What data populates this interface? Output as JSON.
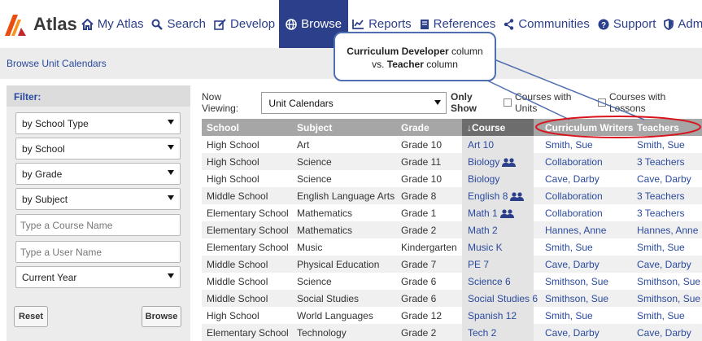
{
  "nav": {
    "logo_text": "Atlas",
    "items": [
      {
        "label": "My Atlas",
        "icon": "home-icon"
      },
      {
        "label": "Search",
        "icon": "search-icon"
      },
      {
        "label": "Develop",
        "icon": "edit-icon"
      },
      {
        "label": "Browse",
        "icon": "globe-icon",
        "active": true
      },
      {
        "label": "Reports",
        "icon": "chart-icon"
      },
      {
        "label": "References",
        "icon": "book-icon"
      },
      {
        "label": "Communities",
        "icon": "share-icon"
      },
      {
        "label": "Support",
        "icon": "question-icon"
      },
      {
        "label": "Admin",
        "icon": "shield-icon"
      }
    ]
  },
  "breadcrumb": "Browse Unit Calendars",
  "filter": {
    "title": "Filter:",
    "school_type": "by School Type",
    "school": "by School",
    "grade": "by Grade",
    "subject": "by Subject",
    "course_placeholder": "Type a Course Name",
    "user_placeholder": "Type a User Name",
    "year": "Current Year",
    "reset": "Reset",
    "browse": "Browse"
  },
  "viewing": {
    "label": "Now Viewing:",
    "value": "Unit Calendars",
    "only_show": "Only Show",
    "opt1": "Courses with Units",
    "opt2": "Courses with Lessons"
  },
  "callout": {
    "bold1": "Curriculum Developer",
    "text1": " column",
    "text2": "vs. ",
    "bold2": "Teacher",
    "text3": " column"
  },
  "table": {
    "headers": {
      "school": "School",
      "subject": "Subject",
      "grade": "Grade",
      "course": "↓Course",
      "writers": "Curriculum Writers",
      "teachers": "Teachers"
    },
    "rows": [
      {
        "school": "High School",
        "subject": "Art",
        "grade": "Grade 10",
        "course": "Art 10",
        "people": false,
        "writers": "Smith, Sue",
        "teachers": "Smith, Sue"
      },
      {
        "school": "High School",
        "subject": "Science",
        "grade": "Grade 11",
        "course": "Biology",
        "people": true,
        "writers": "Collaboration",
        "teachers": "3 Teachers"
      },
      {
        "school": "High School",
        "subject": "Science",
        "grade": "Grade 10",
        "course": "Biology",
        "people": false,
        "writers": "Cave, Darby",
        "teachers": "Cave, Darby"
      },
      {
        "school": "Middle School",
        "subject": "English Language Arts",
        "grade": "Grade 8",
        "course": "English 8",
        "people": true,
        "writers": "Collaboration",
        "teachers": "3 Teachers"
      },
      {
        "school": "Elementary School",
        "subject": "Mathematics",
        "grade": "Grade 1",
        "course": "Math 1",
        "people": true,
        "writers": "Collaboration",
        "teachers": "3 Teachers"
      },
      {
        "school": "Elementary School",
        "subject": "Mathematics",
        "grade": "Grade 2",
        "course": "Math 2",
        "people": false,
        "writers": "Hannes, Anne",
        "teachers": "Hannes, Anne"
      },
      {
        "school": "Elementary School",
        "subject": "Music",
        "grade": "Kindergarten",
        "course": "Music K",
        "people": false,
        "writers": "Smith, Sue",
        "teachers": "Smith, Sue"
      },
      {
        "school": "Middle School",
        "subject": "Physical Education",
        "grade": "Grade 7",
        "course": "PE 7",
        "people": false,
        "writers": "Cave, Darby",
        "teachers": "Cave, Darby"
      },
      {
        "school": "Middle School",
        "subject": "Science",
        "grade": "Grade 6",
        "course": "Science 6",
        "people": false,
        "writers": "Smithson, Sue",
        "teachers": "Smithson, Sue"
      },
      {
        "school": "Middle School",
        "subject": "Social Studies",
        "grade": "Grade 6",
        "course": "Social Studies 6",
        "people": false,
        "writers": "Smithson, Sue",
        "teachers": "Smithson, Sue"
      },
      {
        "school": "High School",
        "subject": "World Languages",
        "grade": "Grade 12",
        "course": "Spanish 12",
        "people": false,
        "writers": "Smith, Sue",
        "teachers": "Smith, Sue"
      },
      {
        "school": "Elementary School",
        "subject": "Technology",
        "grade": "Grade 2",
        "course": "Tech 2",
        "people": false,
        "writers": "Cave, Darby",
        "teachers": "Cave, Darby"
      }
    ]
  },
  "colors": {
    "brand": "#2b3f8a",
    "link": "#2b4a9e",
    "highlight": "#d9121b",
    "callout_border": "#4f6fb0"
  }
}
